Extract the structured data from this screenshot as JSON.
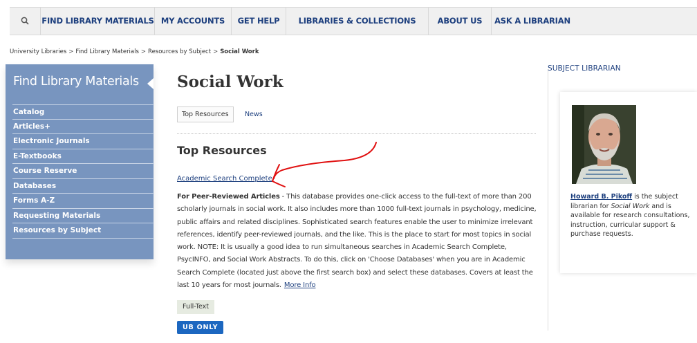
{
  "topnav": {
    "search_icon": "search-icon",
    "items": [
      "FIND LIBRARY MATERIALS",
      "MY ACCOUNTS",
      "GET HELP",
      "LIBRARIES & COLLECTIONS",
      "ABOUT US",
      "ASK A LIBRARIAN"
    ]
  },
  "breadcrumb": {
    "items": [
      "University Libraries",
      "Find Library Materials",
      "Resources by Subject"
    ],
    "separator": ">",
    "current": "Social Work"
  },
  "sidebar": {
    "title": "Find Library Materials",
    "items": [
      "Catalog",
      "Articles+",
      "Electronic Journals",
      "E-Textbooks",
      "Course Reserve",
      "Databases",
      "Forms A-Z",
      "Requesting Materials",
      "Resources by Subject"
    ]
  },
  "main": {
    "title": "Social Work",
    "tabs": [
      "Top Resources",
      "News"
    ],
    "section_title": "Top Resources",
    "resource": {
      "link": "Academic Search Complete",
      "desc_bold": "For Peer-Reviewed Articles",
      "desc_text": " - This database provides one-click access to the full-text of more than 200 scholarly journals in social work. It also includes more than 1000 full-text journals in psychology, medicine, public affairs and related disciplines. Sophisticated search features enable the user to minimize irrelevant references, identify peer-reviewed journals, and the like. This is the place to start for most topics in social work. NOTE: It is usually a good idea to run simultaneous searches in Academic Search Complete, PsycINFO, and Social Work Abstracts. To do this, click on 'Choose Databases' when you are in Academic Search Complete (located just above the first search box) and select these databases. Covers at least the last 10 years for most journals.",
      "more_info": "More Info",
      "badges": [
        "Full-Text",
        "UB ONLY"
      ]
    }
  },
  "subject_librarian": {
    "heading": "SUBJECT LIBRARIAN",
    "name": "Howard B. Pikoff",
    "text_1": " is the subject librarian for ",
    "subject": "Social Work",
    "text_2": " and is available for research consultations, instruction, curricular support & purchase requests."
  },
  "colors": {
    "nav_text": "#1d3f7e",
    "sidebar_bg": "#7895bf",
    "ub_badge": "#1c67c0",
    "annotation": "#e01010"
  }
}
